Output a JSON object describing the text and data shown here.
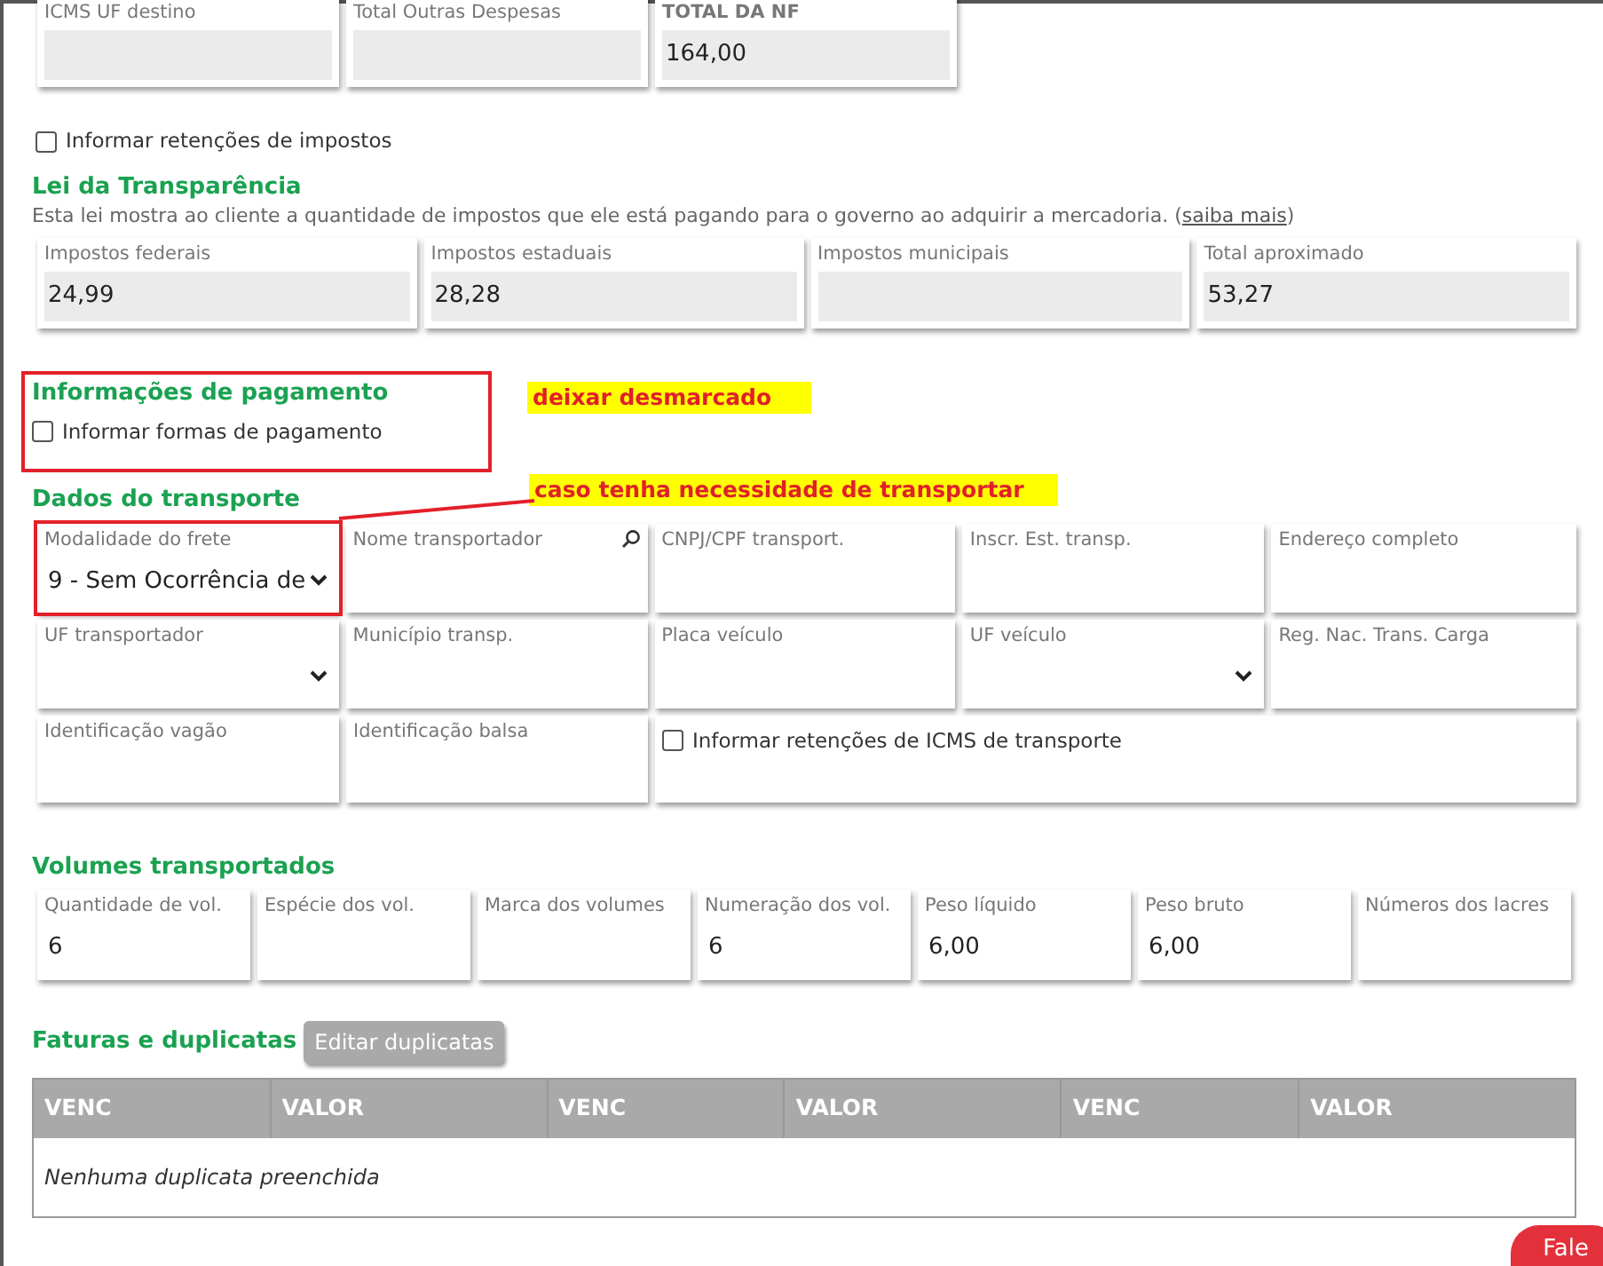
{
  "totals": [
    {
      "label": "ICMS UF destino",
      "bold": false
    },
    {
      "label": "Total Outras Despesas",
      "bold": false
    },
    {
      "label": "TOTAL DA NF",
      "value": "164,00",
      "bold": true
    }
  ],
  "retencoes": {
    "label": "Informar retenções de impostos",
    "checked": false
  },
  "transparencia": {
    "title": "Lei da Transparência",
    "description": "Esta lei mostra ao cliente a quantidade de impostos que ele está pagando para o governo ao adquirir a mercadoria. (",
    "link": "saiba mais",
    "description_end": ")",
    "fields": [
      {
        "label": "Impostos federais",
        "value": "24,99"
      },
      {
        "label": "Impostos estaduais",
        "value": "28,28"
      },
      {
        "label": "Impostos municipais"
      },
      {
        "label": "Total aproximado",
        "value": "53,27"
      }
    ]
  },
  "pagamento": {
    "title": "Informações de pagamento",
    "highlighted": true,
    "checkbox": {
      "label": "Informar formas de pagamento",
      "checked": false
    },
    "note": "deixar desmarcado"
  },
  "transporte": {
    "title": "Dados do transporte",
    "note": "caso tenha necessidade de transportar",
    "rows": [
      [
        {
          "kind": "select",
          "label": "Modalidade do frete",
          "value": "9 - Sem Ocorrência de",
          "highlighted": true
        },
        {
          "kind": "search",
          "label": "Nome transportador",
          "highlighted": false
        },
        {
          "kind": "text",
          "label": "CNPJ/CPF transport.",
          "highlighted": false
        },
        {
          "kind": "text",
          "label": "Inscr. Est. transp.",
          "highlighted": false
        },
        {
          "kind": "text",
          "label": "Endereço completo",
          "highlighted": false
        }
      ],
      [
        {
          "kind": "select",
          "label": "UF transportador",
          "highlighted": false
        },
        {
          "kind": "text",
          "label": "Município transp.",
          "highlighted": false
        },
        {
          "kind": "text",
          "label": "Placa veículo",
          "highlighted": false
        },
        {
          "kind": "select",
          "label": "UF veículo",
          "highlighted": false
        },
        {
          "kind": "text",
          "label": "Reg. Nac. Trans. Carga",
          "highlighted": false
        }
      ],
      [
        {
          "kind": "text",
          "label": "Identificação vagão",
          "highlighted": false
        },
        {
          "kind": "text",
          "label": "Identificação balsa",
          "highlighted": false
        },
        {
          "kind": "checkbox",
          "label": "Informar retenções de ICMS de transporte",
          "checked": false
        }
      ]
    ]
  },
  "volumes": {
    "title": "Volumes transportados",
    "fields": [
      {
        "label": "Quantidade de vol.",
        "value": "6"
      },
      {
        "label": "Espécie dos vol."
      },
      {
        "label": "Marca dos volumes"
      },
      {
        "label": "Numeração dos vol.",
        "value": "6"
      },
      {
        "label": "Peso líquido",
        "value": "6,00"
      },
      {
        "label": "Peso bruto",
        "value": "6,00"
      },
      {
        "label": "Números dos lacres"
      }
    ]
  },
  "faturas": {
    "title": "Faturas e duplicatas",
    "button": "Editar duplicatas",
    "columns": [
      "VENC",
      "VALOR",
      "VENC",
      "VALOR",
      "VENC",
      "VALOR"
    ],
    "empty_message": "Nenhuma duplicata preenchida"
  },
  "chat_button": {
    "label": "Fale"
  }
}
